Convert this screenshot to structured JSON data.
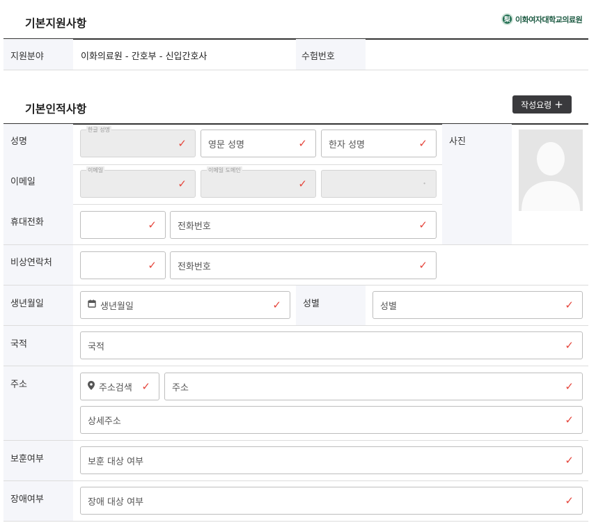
{
  "section1": {
    "title": "기본지원사항",
    "logo_text": "이화여자대학교의료원"
  },
  "application": {
    "field_label": "지원분야",
    "field_value": "이화의료원 - 간호부 - 신입간호사",
    "exam_label": "수험번호",
    "exam_value": ""
  },
  "section2": {
    "title": "기본인적사항",
    "guide_button": "작성요령",
    "guide_icon": "+"
  },
  "name": {
    "label": "성명",
    "korean_float": "한글 성명",
    "english_placeholder": "영문 성명",
    "hanja_placeholder": "한자 성명"
  },
  "photo": {
    "label": "사진"
  },
  "email": {
    "label": "이메일",
    "id_float": "이메일",
    "domain_float": "이메일 도메인"
  },
  "mobile": {
    "label": "휴대전화",
    "number_placeholder": "전화번호"
  },
  "emergency": {
    "label": "비상연락처",
    "number_placeholder": "전화번호"
  },
  "birth": {
    "label": "생년월일",
    "placeholder": "생년월일"
  },
  "gender": {
    "label": "성별",
    "placeholder": "성별"
  },
  "nationality": {
    "label": "국적",
    "placeholder": "국적"
  },
  "address": {
    "label": "주소",
    "search_button": "주소검색",
    "address_placeholder": "주소",
    "detail_placeholder": "상세주소"
  },
  "veteran": {
    "label": "보훈여부",
    "placeholder": "보훈 대상 여부"
  },
  "disability": {
    "label": "장애여부",
    "placeholder": "장애 대상 여부"
  },
  "icons": {
    "check": "✓",
    "calendar": "calendar-icon",
    "pin": "map-pin-icon",
    "dropdown_dot": "•"
  },
  "colors": {
    "check": "#e5443a",
    "button_bg": "#3a3a3d",
    "label_bg": "#f5f6fa",
    "brand": "#1c6b4e"
  }
}
